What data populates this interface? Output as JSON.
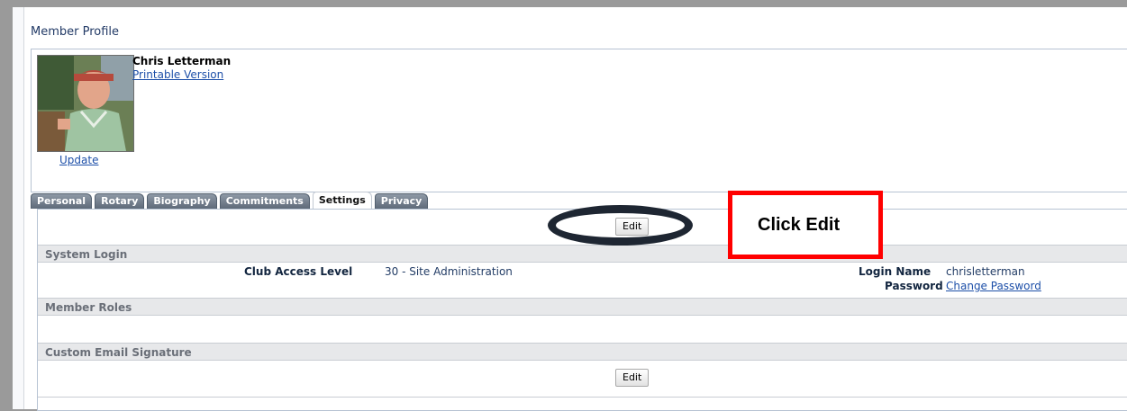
{
  "page": {
    "title": "Member Profile"
  },
  "profile": {
    "name": "Chris Letterman",
    "printable_link": "Printable Version",
    "update_link": "Update"
  },
  "tabs": [
    {
      "label": "Personal",
      "active": false
    },
    {
      "label": "Rotary",
      "active": false
    },
    {
      "label": "Biography",
      "active": false
    },
    {
      "label": "Commitments",
      "active": false
    },
    {
      "label": "Settings",
      "active": true
    },
    {
      "label": "Privacy",
      "active": false
    }
  ],
  "settings": {
    "edit_button": "Edit",
    "system_login": {
      "header": "System Login",
      "club_access_label": "Club Access Level",
      "club_access_value": "30 - Site Administration",
      "login_name_label": "Login Name",
      "login_name_value": "chrisletterman",
      "password_label": "Password",
      "password_link": "Change Password"
    },
    "member_roles": {
      "header": "Member Roles"
    },
    "custom_email": {
      "header": "Custom Email Signature",
      "edit_button": "Edit"
    }
  },
  "annotation": {
    "callout_text": "Click Edit",
    "callout_color": "#ff0000",
    "oval_color": "#1e2632"
  }
}
